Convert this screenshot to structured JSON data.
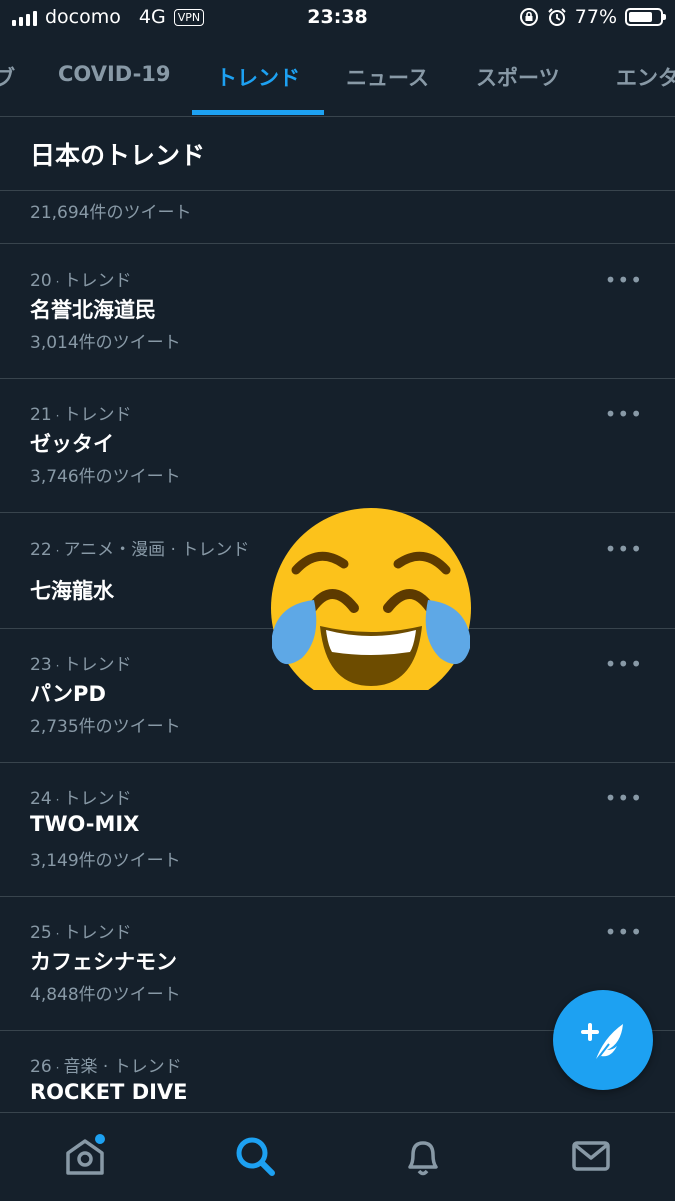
{
  "status_bar": {
    "carrier": "docomo",
    "network": "4G",
    "vpn": "VPN",
    "time": "23:38",
    "battery_text": "77%",
    "battery_level": 0.77
  },
  "tabs": [
    {
      "label": "COVID-19",
      "active": false
    },
    {
      "label": "トレンド",
      "active": true
    },
    {
      "label": "ニュース",
      "active": false
    },
    {
      "label": "スポーツ",
      "active": false
    },
    {
      "label": "エンタ",
      "active": false
    }
  ],
  "section_title": "日本のトレンド",
  "partial_row_count": "21,694件のツイート",
  "trends": [
    {
      "rank": "20",
      "category": "トレンド",
      "name": "名誉北海道民",
      "tweets": "3,014件のツイート"
    },
    {
      "rank": "21",
      "category": "トレンド",
      "name": "ゼッタイ",
      "tweets": "3,746件のツイート"
    },
    {
      "rank": "22",
      "category": "アニメ・漫画 · トレンド",
      "name": "七海龍水",
      "tweets": ""
    },
    {
      "rank": "23",
      "category": "トレンド",
      "name": "パンPD",
      "tweets": "2,735件のツイート"
    },
    {
      "rank": "24",
      "category": "トレンド",
      "name": "TWO-MIX",
      "tweets": "3,149件のツイート"
    },
    {
      "rank": "25",
      "category": "トレンド",
      "name": "カフェシナモン",
      "tweets": "4,848件のツイート"
    },
    {
      "rank": "26",
      "category": "音楽 · トレンド",
      "name": "ROCKET DIVE",
      "tweets": ""
    }
  ],
  "more_icon": "•••",
  "emoji": "face-with-tears-of-joy",
  "colors": {
    "background": "#15202b",
    "accent": "#1da1f2",
    "muted": "#8899a6",
    "divider": "#38444d"
  }
}
